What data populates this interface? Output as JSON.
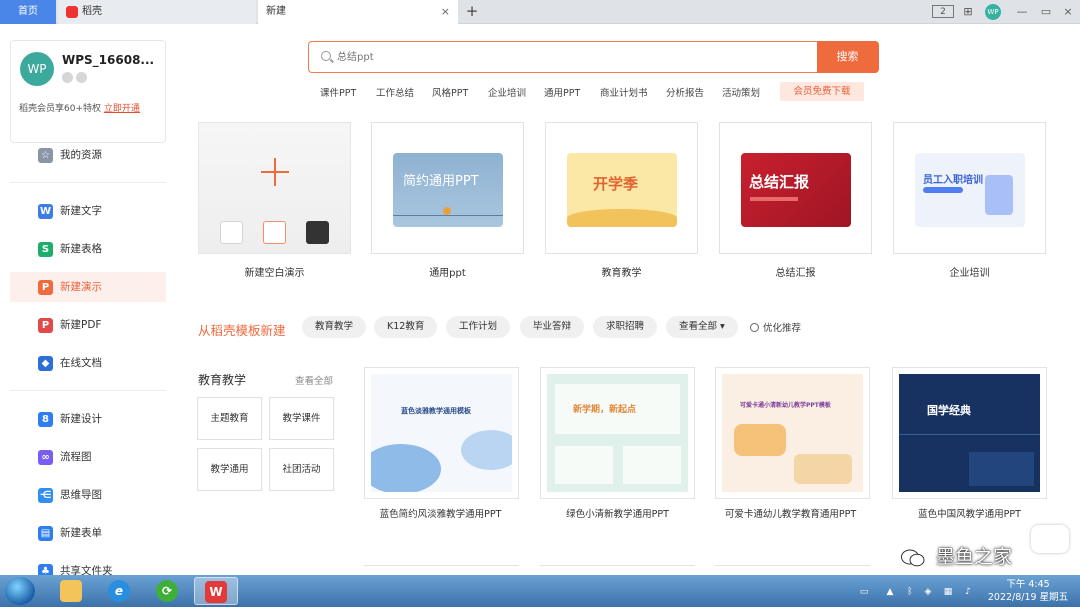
{
  "tabs": {
    "home": "首页",
    "daoke": "稻壳",
    "new": "新建",
    "close_glyph": "×",
    "add_glyph": "+"
  },
  "window": {
    "avatar_text": "WP",
    "controls": [
      "2",
      "⊞",
      "",
      "—",
      "▭",
      "×"
    ]
  },
  "user": {
    "avatar_text": "WP",
    "name": "WPS_16608...",
    "vip_prefix": "稻壳会员享60+特权",
    "vip_link": "立即开通"
  },
  "sidebar": {
    "items": [
      {
        "label": "我的资源",
        "icon": "star-icon",
        "color": "#8a96a8"
      },
      {
        "label": "新建文字",
        "icon": "writer-icon",
        "color": "#3c7ee4"
      },
      {
        "label": "新建表格",
        "icon": "spreadsheet-icon",
        "color": "#1eae6b"
      },
      {
        "label": "新建演示",
        "icon": "presentation-icon",
        "color": "#ef6a3d"
      },
      {
        "label": "新建PDF",
        "icon": "pdf-icon",
        "color": "#e24a4a"
      },
      {
        "label": "在线文档",
        "icon": "cloud-doc-icon",
        "color": "#2c6fd8"
      },
      {
        "label": "新建设计",
        "icon": "design-icon",
        "color": "#2f7ef0"
      },
      {
        "label": "流程图",
        "icon": "flowchart-icon",
        "color": "#7a5df2"
      },
      {
        "label": "思维导图",
        "icon": "mindmap-icon",
        "color": "#2f8ef0"
      },
      {
        "label": "新建表单",
        "icon": "form-icon",
        "color": "#2f7ef0"
      },
      {
        "label": "共享文件夹",
        "icon": "shared-folder-icon",
        "color": "#2f7ef0"
      }
    ]
  },
  "search": {
    "placeholder": "总结ppt",
    "button": "搜索"
  },
  "hot_tags": [
    "课件PPT",
    "工作总结",
    "风格PPT",
    "企业培训",
    "通用PPT",
    "商业计划书",
    "分析报告",
    "活动策划"
  ],
  "member_download": "会员免费下载",
  "quick_cards": [
    {
      "caption": "新建空白演示"
    },
    {
      "caption": "通用ppt",
      "thumb_title": "简约通用PPT",
      "bg": "#7ea1c2"
    },
    {
      "caption": "教育教学",
      "thumb_title": "开学季",
      "bg": "#fbe7a6"
    },
    {
      "caption": "总结汇报",
      "thumb_title": "总结汇报",
      "bg": "#c8202e"
    },
    {
      "caption": "企业培训",
      "thumb_title": "员工入职培训",
      "bg": "#eef2fb"
    }
  ],
  "section": {
    "title": "从稻壳模板新建",
    "filters": [
      "教育教学",
      "K12教育",
      "工作计划",
      "毕业答辩",
      "求职招聘",
      "查看全部 ▾"
    ],
    "optimize": "优化推荐"
  },
  "category": {
    "title": "教育教学",
    "view_all": "查看全部",
    "boxes": [
      "主题教育",
      "教学课件",
      "教学通用",
      "社团活动"
    ]
  },
  "templates": [
    {
      "caption": "蓝色简约风淡雅教学通用PPT",
      "inner_title": "蓝色淡雅教学通用模板"
    },
    {
      "caption": "绿色小清新教学通用PPT",
      "inner_title": "新学期，新起点"
    },
    {
      "caption": "可爱卡通幼儿教学教育通用PPT",
      "inner_title": "可爱卡通小清新幼儿教学PPT模板"
    },
    {
      "caption": "蓝色中国风教学通用PPT",
      "inner_title": "国学经典"
    }
  ],
  "watermark": "墨鱼之家",
  "taskbar": {
    "time": "下午 4:45",
    "date": "2022/8/19 星期五"
  }
}
